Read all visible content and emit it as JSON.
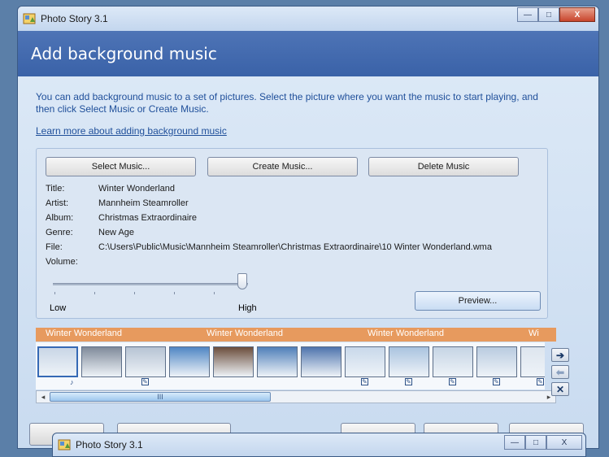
{
  "window": {
    "title": "Photo Story 3.1",
    "controls": {
      "minimize": "—",
      "maximize": "□",
      "close": "X"
    }
  },
  "header": {
    "title": "Add background music"
  },
  "intro": {
    "text": "You can add background music to a set of pictures.  Select the picture where you want the music to start playing, and then click Select Music or Create Music.",
    "learn_link": "Learn more about adding background music"
  },
  "music_panel": {
    "select_label": "Select Music...",
    "create_label": "Create Music...",
    "delete_label": "Delete Music",
    "info": [
      {
        "key": "Title:",
        "value": "Winter Wonderland"
      },
      {
        "key": "Artist:",
        "value": "Mannheim Steamroller"
      },
      {
        "key": "Album:",
        "value": "Christmas Extraordinaire"
      },
      {
        "key": "Genre:",
        "value": "New Age"
      },
      {
        "key": "File:",
        "value": "C:\\Users\\Public\\Music\\Mannheim Steamroller\\Christmas Extraordinaire\\10 Winter Wonderland.wma"
      },
      {
        "key": "Volume:",
        "value": ""
      }
    ],
    "volume": {
      "low_label": "Low",
      "high_label": "High",
      "level": 0.97
    },
    "preview_label": "Preview..."
  },
  "timeline": {
    "track_labels": [
      "Winter Wonderland",
      "Winter Wonderland",
      "Winter Wonderland",
      "Wi"
    ],
    "track_color": "#e79a5e",
    "thumbnails": [
      {
        "selected": true,
        "edited": false,
        "music": true,
        "color": "#c9d6e6"
      },
      {
        "selected": false,
        "edited": false,
        "music": false,
        "color": "#7f8a9a"
      },
      {
        "selected": false,
        "edited": true,
        "music": false,
        "color": "#b6c3d3"
      },
      {
        "selected": false,
        "edited": false,
        "music": false,
        "color": "#4f86c4"
      },
      {
        "selected": false,
        "edited": false,
        "music": false,
        "color": "#6b4d3b"
      },
      {
        "selected": false,
        "edited": false,
        "music": false,
        "color": "#4f7fb9"
      },
      {
        "selected": false,
        "edited": false,
        "music": false,
        "color": "#4e74ad"
      },
      {
        "selected": false,
        "edited": true,
        "music": false,
        "color": "#c8d8ea"
      },
      {
        "selected": false,
        "edited": true,
        "music": false,
        "color": "#a9c3df"
      },
      {
        "selected": false,
        "edited": true,
        "music": false,
        "color": "#c5d4e4"
      },
      {
        "selected": false,
        "edited": true,
        "music": false,
        "color": "#b9cbe0"
      },
      {
        "selected": false,
        "edited": true,
        "music": false,
        "color": "#dde5ee"
      }
    ],
    "scroll_thumb_label": "III"
  },
  "side_controls": {
    "right_arrow": "➔",
    "left_arrow": "⬅",
    "remove": "✕"
  },
  "second_window": {
    "title": "Photo Story 3.1"
  }
}
